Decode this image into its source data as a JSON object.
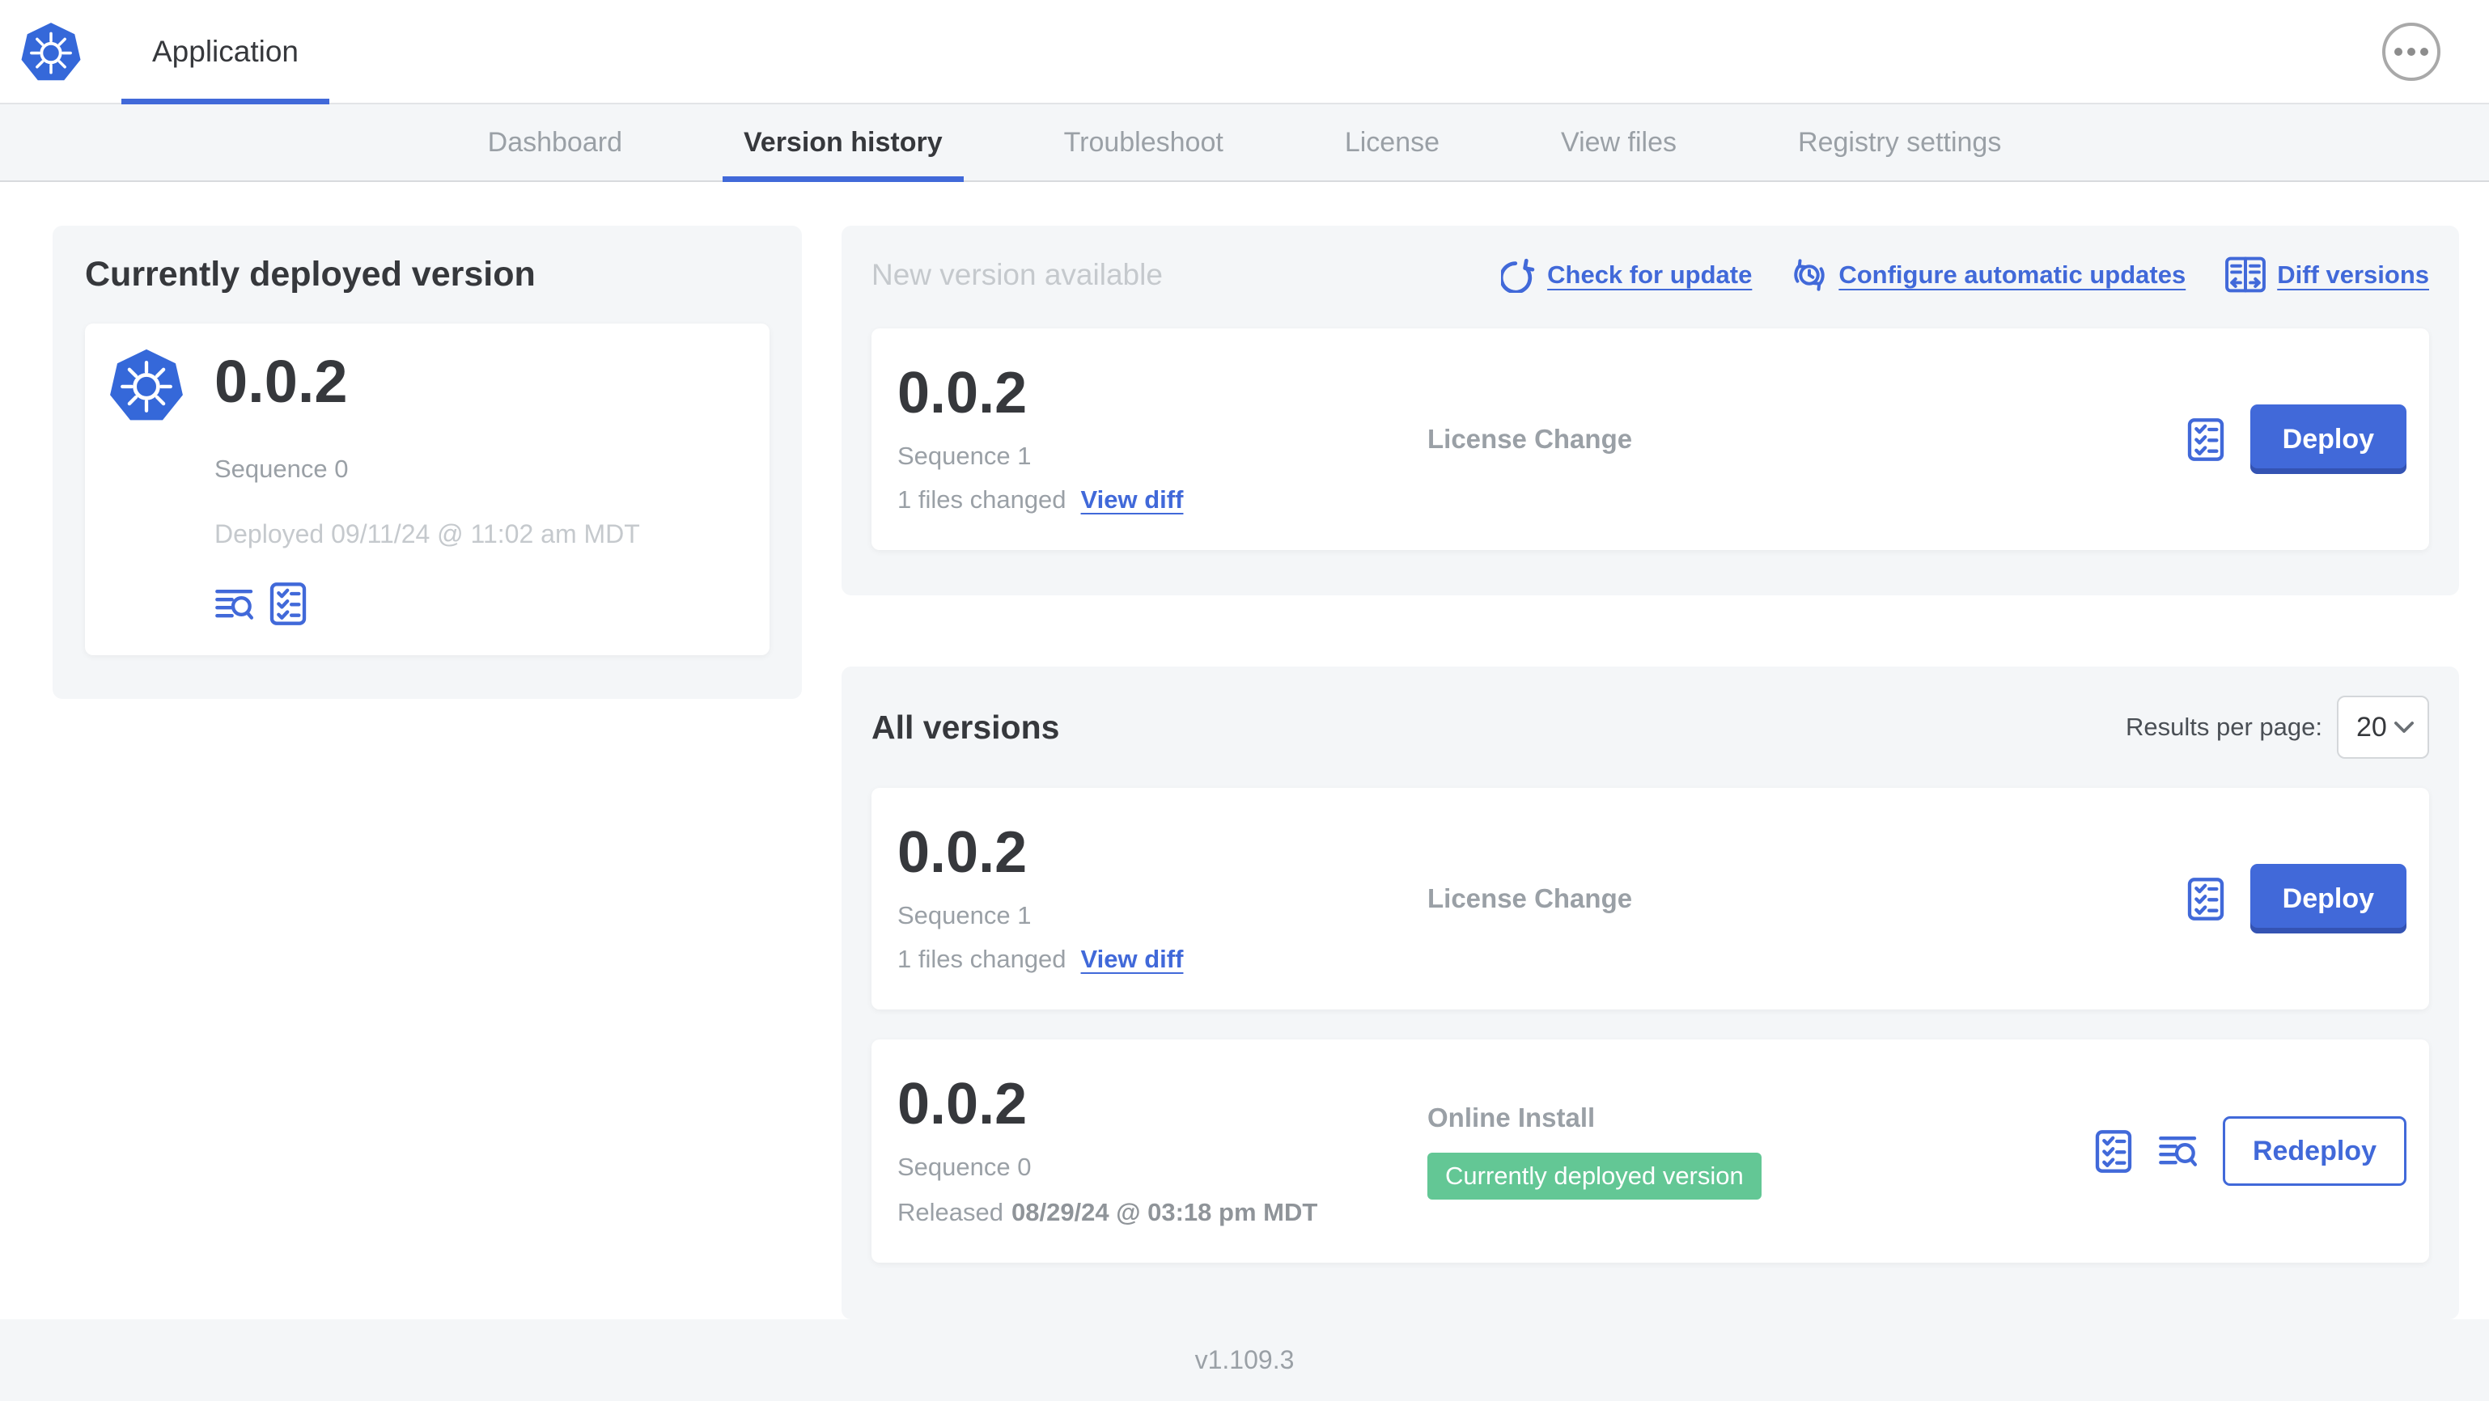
{
  "header": {
    "app_name": "Application"
  },
  "nav": {
    "tabs": [
      "Dashboard",
      "Version history",
      "Troubleshoot",
      "License",
      "View files",
      "Registry settings"
    ],
    "active_tab": "Version history"
  },
  "currently_deployed": {
    "title": "Currently deployed version",
    "version": "0.0.2",
    "sequence": "Sequence 0",
    "deployed_at": "Deployed 09/11/24 @ 11:02 am MDT"
  },
  "new_version": {
    "title": "New version available",
    "links": {
      "check_for_update": "Check for update",
      "configure_automatic_updates": "Configure automatic updates",
      "diff_versions": "Diff versions"
    },
    "row": {
      "version": "0.0.2",
      "sequence": "Sequence 1",
      "files_changed": "1 files changed",
      "view_diff": "View diff",
      "source": "License Change",
      "action": "Deploy"
    }
  },
  "all_versions": {
    "title": "All versions",
    "results_per_page_label": "Results per page:",
    "results_per_page_value": "20",
    "rows": [
      {
        "version": "0.0.2",
        "sequence": "Sequence 1",
        "files_changed": "1 files changed",
        "view_diff": "View diff",
        "source": "License Change",
        "action": "Deploy"
      },
      {
        "version": "0.0.2",
        "sequence": "Sequence 0",
        "released_prefix": "Released",
        "released_date": "08/29/24 @ 03:18 pm MDT",
        "source": "Online Install",
        "badge": "Currently deployed version",
        "action": "Redeploy"
      }
    ]
  },
  "footer": {
    "console_version": "v1.109.3"
  },
  "icons": {
    "app_logo": "kubernetes-logo",
    "menu": "ellipsis-icon",
    "check_for_update": "refresh-icon",
    "configure_automatic_updates": "clock-sync-icon",
    "diff_versions": "diff-icon",
    "release_notes": "lines-magnifier-icon",
    "preflight": "checklist-icon",
    "select": "chevron-down-icon"
  },
  "colors": {
    "primary_blue": "#4169d9",
    "badge_green": "#63c795",
    "card_bg": "#f4f6f8",
    "muted_text": "#9aa0a6",
    "faint_text": "#c5c9cd"
  }
}
